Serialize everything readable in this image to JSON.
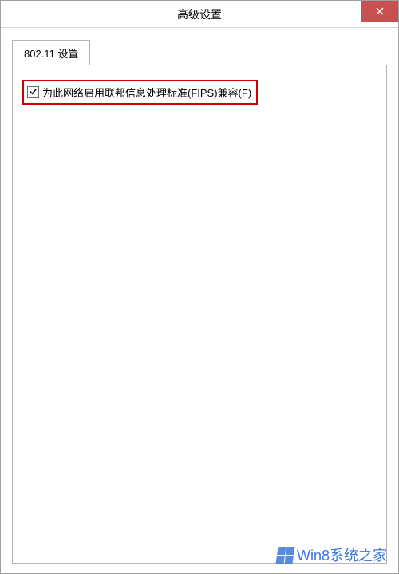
{
  "window": {
    "title": "高级设置"
  },
  "tabs": {
    "tab1": {
      "label": "802.11 设置"
    }
  },
  "fips": {
    "label": "为此网络启用联邦信息处理标准(FIPS)兼容(F)",
    "checked": true
  },
  "watermark": {
    "text": "Win8系统之家"
  }
}
